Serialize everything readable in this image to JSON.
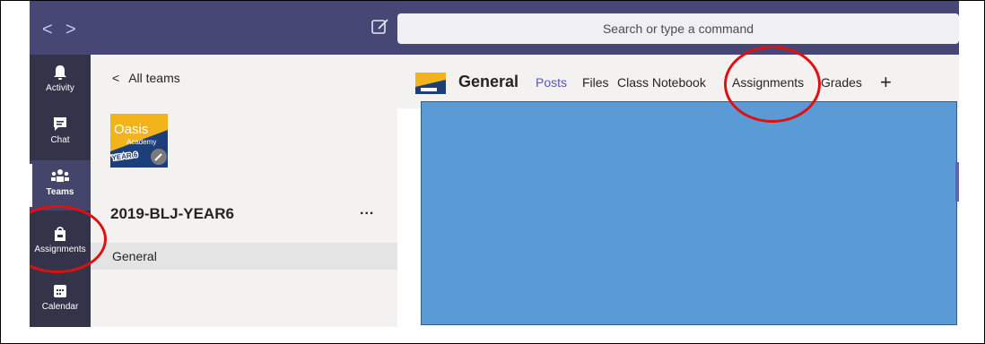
{
  "topbar": {
    "back_glyph": "<",
    "forward_glyph": ">",
    "compose_icon": "compose-icon",
    "search_placeholder": "Search or type a command"
  },
  "rail": {
    "items": [
      {
        "label": "Activity",
        "icon": "bell-icon",
        "active": false
      },
      {
        "label": "Chat",
        "icon": "chat-icon",
        "active": false
      },
      {
        "label": "Teams",
        "icon": "teams-icon",
        "active": true
      },
      {
        "label": "Assignments",
        "icon": "assignments-icon",
        "active": false
      },
      {
        "label": "Calendar",
        "icon": "calendar-icon",
        "active": false
      }
    ]
  },
  "team": {
    "back_label": "All teams",
    "name": "2019-BLJ-YEAR6",
    "more_label": "...",
    "channel": "General",
    "logo_text": {
      "line1": "Oasis",
      "line2": "Academy",
      "line3": "YEAR 6"
    }
  },
  "channel_header": {
    "title": "General",
    "tabs": [
      {
        "label": "Posts",
        "active": true
      },
      {
        "label": "Files",
        "active": false
      },
      {
        "label": "Class Notebook",
        "active": false
      },
      {
        "label": "Assignments",
        "active": false
      },
      {
        "label": "Grades",
        "active": false
      }
    ],
    "add_tab": "+"
  },
  "colors": {
    "topbar": "#464775",
    "rail": "#33344a",
    "accent": "#5558af",
    "content_block": "#5b9bd5",
    "annotation": "#e01010"
  }
}
